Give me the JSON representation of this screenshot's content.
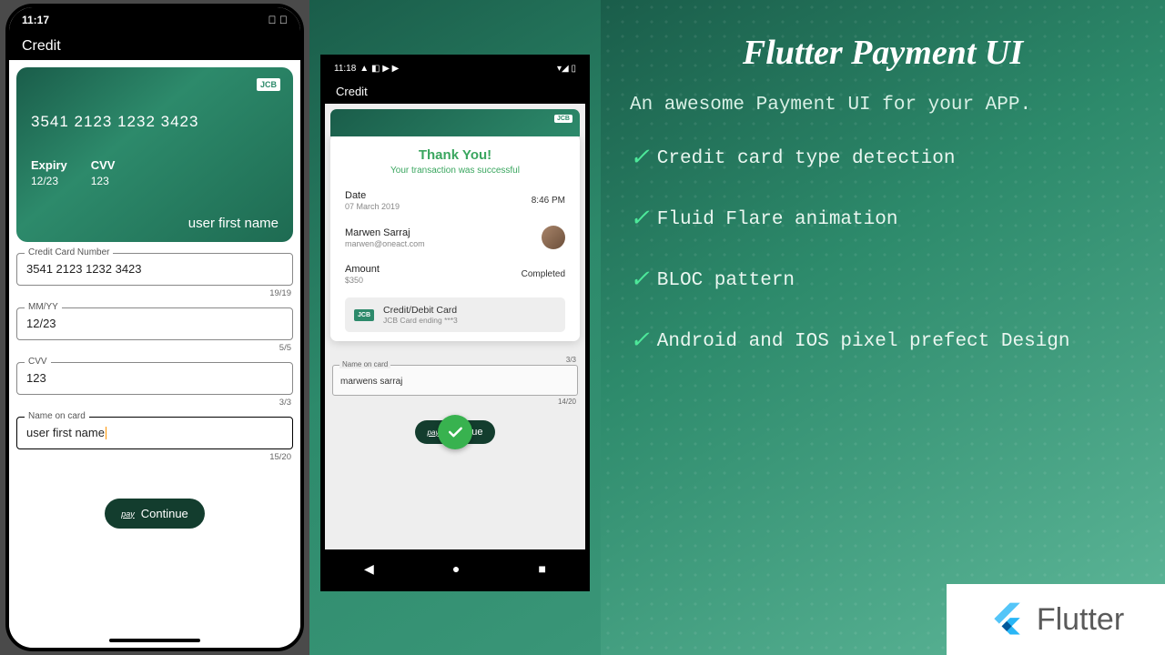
{
  "phone1": {
    "time": "11:17",
    "header": "Credit",
    "card": {
      "brand": "JCB",
      "number": "3541 2123 1232 3423",
      "expiry_label": "Expiry",
      "expiry": "12/23",
      "cvv_label": "CVV",
      "cvv": "123",
      "holder": "user first name"
    },
    "form": {
      "cc_label": "Credit Card Number",
      "cc_value": "3541 2123 1232 3423",
      "cc_counter": "19/19",
      "mmyy_label": "MM/YY",
      "mmyy_value": "12/23",
      "mmyy_counter": "5/5",
      "cvv_label": "CVV",
      "cvv_value": "123",
      "cvv_counter": "3/3",
      "name_label": "Name on card",
      "name_value": "user first name",
      "name_counter": "15/20",
      "btn_prefix": "pay",
      "btn_label": "Continue"
    }
  },
  "phone2": {
    "time": "11:18",
    "header": "Credit",
    "card_brand": "JCB",
    "receipt": {
      "title": "Thank You!",
      "subtitle": "Your transaction was successful",
      "date_label": "Date",
      "date_value": "07 March 2019",
      "time": "8:46 PM",
      "name": "Marwen Sarraj",
      "email": "marwen@oneact.com",
      "amount_label": "Amount",
      "amount_value": "$350",
      "status": "Completed",
      "method_title": "Credit/Debit Card",
      "method_sub": "JCB Card ending ***3",
      "method_brand": "JCB"
    },
    "lower": {
      "top_counter": "3/3",
      "name_label": "Name on card",
      "name_value": "marwens sarraj",
      "name_counter": "14/20",
      "btn_prefix": "pay",
      "btn_label": "Continue"
    }
  },
  "panel": {
    "title": "Flutter Payment UI",
    "subtitle": "An awesome Payment UI for your APP.",
    "features": [
      "Credit card type detection",
      "Fluid Flare animation",
      "BLOC pattern",
      "Android and IOS pixel prefect Design"
    ],
    "logo_text": "Flutter"
  }
}
